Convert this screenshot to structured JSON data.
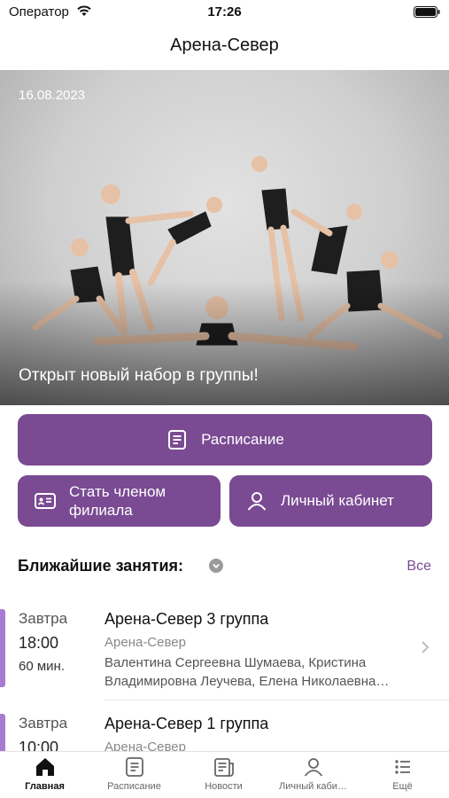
{
  "status_bar": {
    "carrier": "Оператор",
    "time": "17:26"
  },
  "header": {
    "title": "Арена-Север"
  },
  "hero": {
    "date": "16.08.2023",
    "caption": "Открыт новый набор в группы!"
  },
  "actions": {
    "schedule": "Расписание",
    "become_member": "Стать членом\nфилиала",
    "personal_cabinet": "Личный кабинет"
  },
  "upcoming": {
    "title": "Ближайшие занятия:",
    "all_link": "Все",
    "lessons": [
      {
        "day": "Завтра",
        "time": "18:00",
        "duration": "60 мин.",
        "title": "Арена-Север 3 группа",
        "branch": "Арена-Север",
        "teachers": "Валентина Сергеевна Шумаева, Кристина Владимировна Леучева, Елена Николаевна…"
      },
      {
        "day": "Завтра",
        "time": "10:00",
        "duration": "",
        "title": "Арена-Север 1 группа",
        "branch": "Арена-Север",
        "teachers": ""
      }
    ]
  },
  "tabs": [
    {
      "label": "Главная",
      "icon": "home-icon",
      "active": true
    },
    {
      "label": "Расписание",
      "icon": "schedule-icon",
      "active": false
    },
    {
      "label": "Новости",
      "icon": "news-icon",
      "active": false
    },
    {
      "label": "Личный каби…",
      "icon": "user-icon",
      "active": false
    },
    {
      "label": "Ещё",
      "icon": "more-icon",
      "active": false
    }
  ],
  "colors": {
    "accent": "#7a4a93",
    "lesson_marker": "#a77bd1"
  }
}
